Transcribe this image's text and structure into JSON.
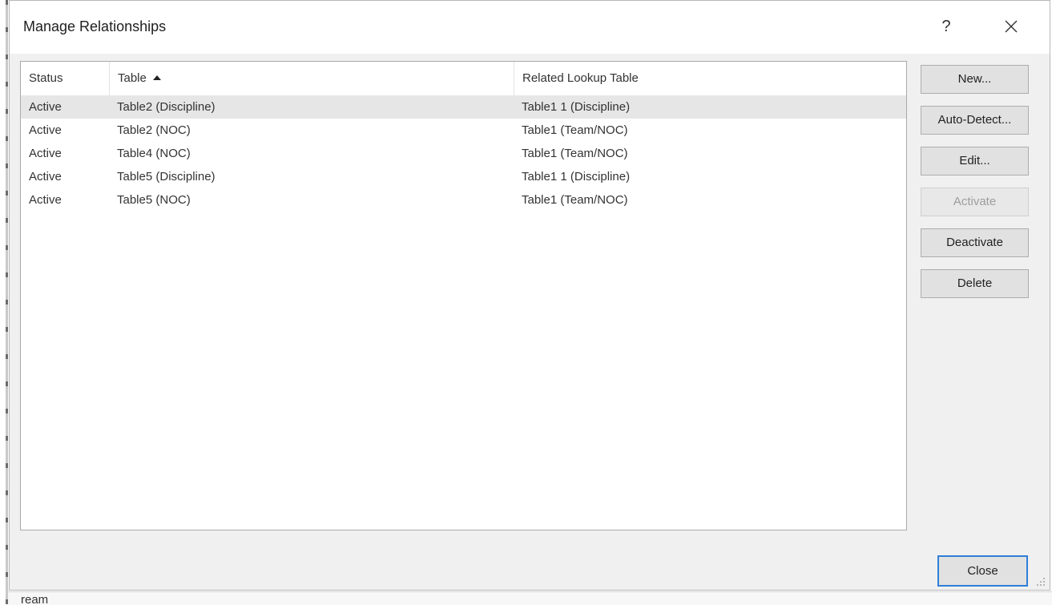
{
  "dialog": {
    "title": "Manage Relationships",
    "help_label": "?"
  },
  "list": {
    "columns": [
      {
        "label": "Status"
      },
      {
        "label": "Table",
        "sort": "ascending"
      },
      {
        "label": "Related Lookup Table"
      }
    ],
    "rows": [
      {
        "status": "Active",
        "table": "Table2 (Discipline)",
        "related": "Table1 1 (Discipline)",
        "selected": true
      },
      {
        "status": "Active",
        "table": "Table2 (NOC)",
        "related": "Table1 (Team/NOC)",
        "selected": false
      },
      {
        "status": "Active",
        "table": "Table4 (NOC)",
        "related": "Table1 (Team/NOC)",
        "selected": false
      },
      {
        "status": "Active",
        "table": "Table5 (Discipline)",
        "related": "Table1 1 (Discipline)",
        "selected": false
      },
      {
        "status": "Active",
        "table": "Table5 (NOC)",
        "related": "Table1 (Team/NOC)",
        "selected": false
      }
    ]
  },
  "buttons": {
    "new": "New...",
    "auto_detect": "Auto-Detect...",
    "edit": "Edit...",
    "activate": "Activate",
    "deactivate": "Deactivate",
    "delete": "Delete",
    "close": "Close"
  },
  "background": {
    "partial_text": "ream"
  },
  "colors": {
    "selected_row": "#e6e6e6",
    "focus_border": "#2f7fd6",
    "dialog_bg": "#f0f0f0"
  }
}
